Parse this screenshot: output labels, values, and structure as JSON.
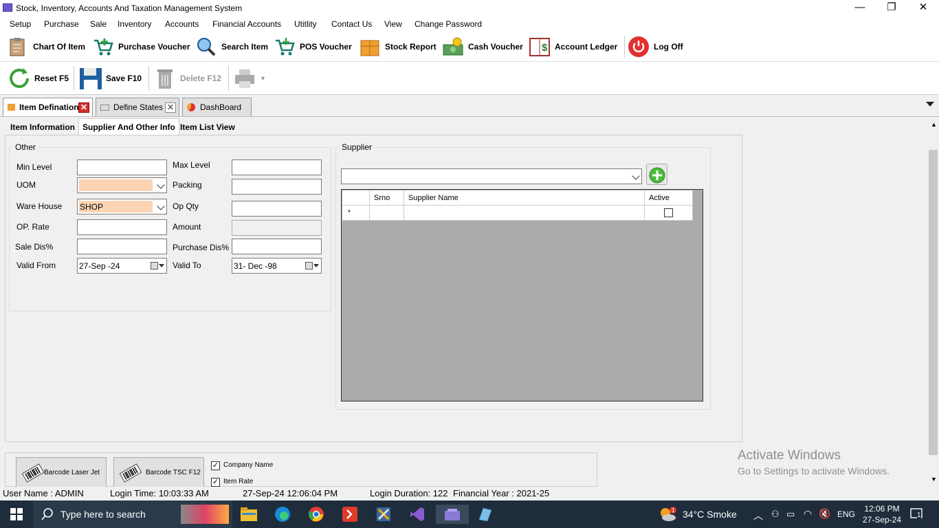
{
  "window": {
    "title": "Stock, Inventory, Accounts And Taxation Management System",
    "minimize": "—",
    "restore": "❐",
    "close": "✕"
  },
  "menu": [
    "Setup",
    "Purchase",
    "Sale",
    "Inventory",
    "Accounts",
    "Financial Accounts",
    "Utitlity",
    "Contact Us",
    "View",
    "Change Password"
  ],
  "toolbar": {
    "chart_of_item": "Chart Of Item",
    "purchase_voucher": "Purchase Voucher",
    "search_item": "Search Item",
    "pos_voucher": "POS Voucher",
    "stock_report": "Stock Report",
    "cash_voucher": "Cash Voucher",
    "account_ledger": "Account Ledger",
    "log_off": "Log Off"
  },
  "toolbar2": {
    "reset": "Reset F5",
    "save": "Save F10",
    "delete": "Delete F12"
  },
  "doc_tabs": [
    "Item Defination",
    "Define States",
    "DashBoard"
  ],
  "inner_tabs": [
    "Item Information",
    "Supplier And Other Info",
    "Item List View"
  ],
  "other": {
    "group_label": "Other",
    "min_level": "Min Level",
    "max_level": "Max Level",
    "uom": "UOM",
    "packing": "Packing",
    "ware_house": "Ware House",
    "ware_house_value": "SHOP",
    "op_qty": "Op Qty",
    "op_rate": "OP. Rate",
    "amount": "Amount",
    "sale_dis": "Sale Dis%",
    "purchase_dis": "Purchase Dis%",
    "valid_from": "Valid From",
    "valid_from_value": "27-Sep -24",
    "valid_to": "Valid To",
    "valid_to_value": "31- Dec -98"
  },
  "supplier": {
    "group_label": "Supplier",
    "columns": [
      "Srno",
      "Supplier Name",
      "Active"
    ],
    "new_row_marker": "*"
  },
  "bottom": {
    "barcode_laser": "Barcode Laser Jet",
    "barcode_tsc": "Barcode TSC F12",
    "company_name": "Company Name",
    "item_rate": "Item Rate"
  },
  "status": {
    "user": "User Name : ADMIN",
    "login_time": "Login Time:   10:03:33 AM",
    "datetime": "27-Sep-24 12:06:04 PM",
    "login_duration": "Login Duration: 122",
    "financial_year": "Financial Year : 2021-25"
  },
  "watermark": {
    "line1": "Activate Windows",
    "line2": "Go to Settings to activate Windows."
  },
  "taskbar": {
    "search_placeholder": "Type here to search",
    "weather": "34°C  Smoke",
    "lang": "ENG",
    "time": "12:06 PM",
    "date": "27-Sep-24",
    "notification_count": "1"
  }
}
